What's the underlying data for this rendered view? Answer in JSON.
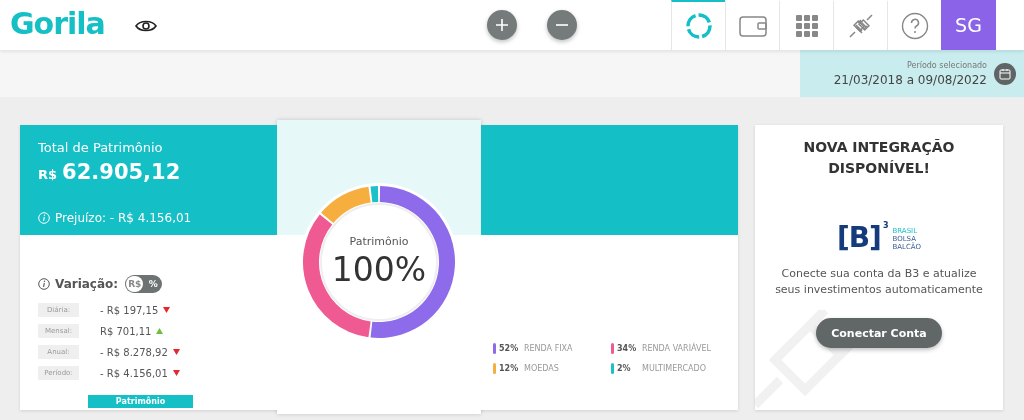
{
  "header": {
    "logo": "Gorila",
    "nav": [
      {
        "kind": "donut",
        "selected": true
      },
      {
        "kind": "wallet",
        "selected": false
      },
      {
        "kind": "grid",
        "selected": false
      },
      {
        "kind": "plug",
        "selected": false
      },
      {
        "kind": "help",
        "selected": false
      }
    ],
    "avatar": "SG"
  },
  "period": {
    "label": "Período selecionado",
    "value": "21/03/2018 a 09/08/2022"
  },
  "summary": {
    "title": "Total de Patrimônio",
    "currency": "R$",
    "amount": "62.905,12",
    "loss": "Prejuízo: - R$ 4.156,01"
  },
  "variation": {
    "label": "Variação:",
    "toggle": [
      {
        "label": "R$",
        "selected": true
      },
      {
        "label": "%",
        "selected": false
      }
    ],
    "rows": [
      {
        "label": "Diária:",
        "value": "- R$ 197,15",
        "rising": false
      },
      {
        "label": "Mensal:",
        "value": "R$ 701,11",
        "rising": true
      },
      {
        "label": "Anual:",
        "value": "- R$ 8.278,92",
        "rising": false
      },
      {
        "label": "Período:",
        "value": "- R$ 4.156,01",
        "rising": false
      }
    ],
    "tab": "Patrimônio"
  },
  "allocation": {
    "center_label": "Patrimônio",
    "center_value": "100%",
    "chart_data": {
      "type": "donut",
      "categories": [
        "RENDA FIXA",
        "RENDA VARIÁVEL",
        "MOEDAS",
        "MULTIMERCADO"
      ],
      "values": [
        52,
        34,
        12,
        2
      ]
    },
    "legend": [
      {
        "percent": "52%",
        "color": "#8e6bea"
      },
      {
        "percent": "34%",
        "color": "#ef5a92"
      },
      {
        "percent": "12%",
        "color": "#f6ae3f"
      },
      {
        "percent": "2%",
        "color": "#1bc1c9"
      }
    ]
  },
  "integration": {
    "title": "NOVA INTEGRAÇÃO DISPONÍVEL!",
    "logo_mark": "[B]",
    "logo_sup": "3",
    "logo_lines": [
      "BRASIL",
      "BOLSA",
      "BALCÃO"
    ],
    "text": "Conecte sua conta da B3 e atualize seus investimentos automaticamente",
    "button": "Conectar Conta"
  }
}
